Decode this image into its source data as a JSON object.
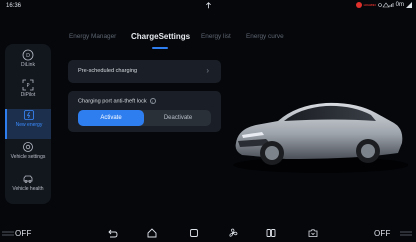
{
  "status": {
    "time": "16:36",
    "operator": "HUAWEI",
    "right_text": "0m"
  },
  "sidebar": {
    "items": [
      {
        "label": "DiLink",
        "icon": "dilink-icon"
      },
      {
        "label": "DiPilot",
        "icon": "dipilot-icon"
      },
      {
        "label": "New energy",
        "icon": "new-energy-icon"
      },
      {
        "label": "Vehicle settings",
        "icon": "vehicle-settings-icon"
      },
      {
        "label": "Vehicle health",
        "icon": "vehicle-health-icon"
      }
    ],
    "active_index": 2
  },
  "tabs": [
    {
      "label": "Energy Manager"
    },
    {
      "label": "ChargeSettings"
    },
    {
      "label": "Energy list"
    },
    {
      "label": "Energy curve"
    }
  ],
  "active_tab": 1,
  "settings": {
    "pre_scheduled_label": "Pre-scheduled charging",
    "antitheft_label": "Charging port anti-theft lock",
    "activate_label": "Activate",
    "deactivate_label": "Deactivate",
    "selected": "Activate"
  },
  "bottom": {
    "ac_left": "OFF",
    "ac_right": "OFF",
    "dock_icons": [
      "back-icon",
      "home-icon",
      "recent-apps-icon",
      "fan-icon",
      "split-screen-icon",
      "camera-icon"
    ]
  },
  "colors": {
    "accent": "#2f7ef0",
    "background": "#05070b",
    "card": "#1a1f27"
  }
}
